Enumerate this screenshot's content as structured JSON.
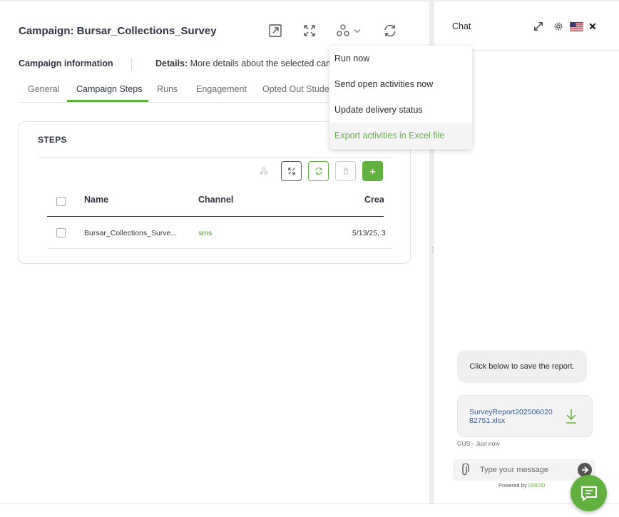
{
  "header": {
    "title": "Campaign: Bursar_Collections_Survey",
    "icons": [
      "open-external-icon",
      "expand-icon",
      "workflow-icon",
      "chevron-down-icon",
      "refresh-icon"
    ]
  },
  "info": {
    "label": "Campaign information",
    "details_label": "Details:",
    "details_text": "More details about the selected campaign"
  },
  "tabs": [
    {
      "label": "General",
      "active": false
    },
    {
      "label": "Campaign Steps",
      "active": true
    },
    {
      "label": "Runs",
      "active": false
    },
    {
      "label": "Engagement",
      "active": false
    },
    {
      "label": "Opted Out Students",
      "active": false
    }
  ],
  "steps": {
    "title": "STEPS",
    "toolbar": {
      "add_label": "+"
    },
    "columns": [
      "Name",
      "Channel",
      "Created"
    ],
    "rows": [
      {
        "name": "Bursar_Collections_Surve...",
        "channel": "sms",
        "created": "5/13/25, 3"
      }
    ]
  },
  "menu": {
    "items": [
      {
        "label": "Run now",
        "highlighted": false
      },
      {
        "label": "Send open activities now",
        "highlighted": false
      },
      {
        "label": "Update delivery status",
        "highlighted": false
      },
      {
        "label": "Export activities in Excel file",
        "highlighted": true
      }
    ]
  },
  "chat": {
    "title": "Chat",
    "bubble_text": "Click below to save the report.",
    "file_name": "SurveyReport20250602082751.xlsx",
    "meta": "GUS - Just now",
    "input_placeholder": "Type your message",
    "powered_by": "Powered by",
    "brand": "DRUID"
  },
  "colors": {
    "accent": "#62b140",
    "text_dark": "#2e3440",
    "link": "#3a5a8c"
  }
}
